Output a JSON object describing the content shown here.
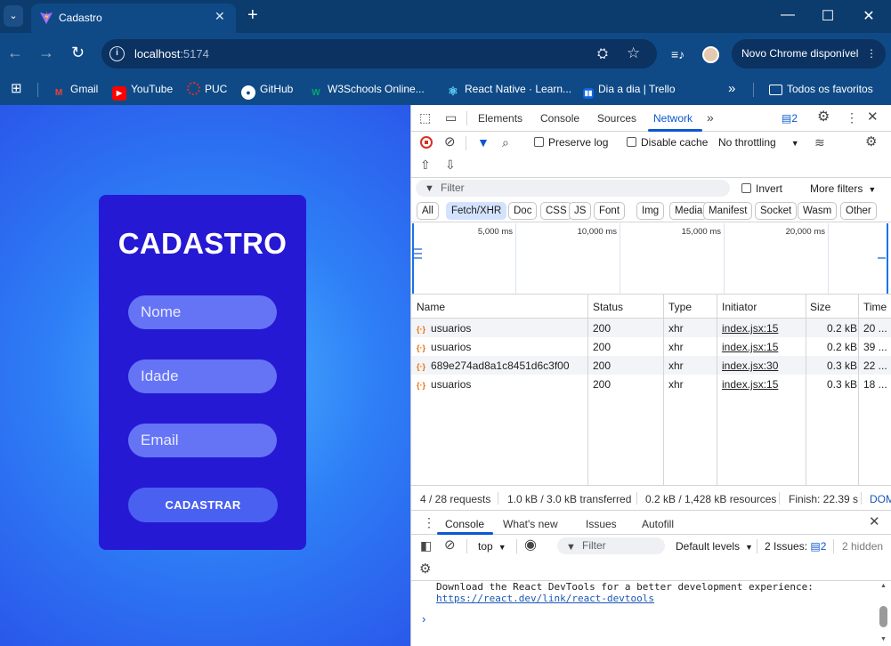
{
  "tab": {
    "title": "Cadastro",
    "close": "✕"
  },
  "window": {
    "minimize": "—",
    "maximize": "☐",
    "close": "✕",
    "new_tab": "+",
    "tab_search": "⌄"
  },
  "omnibox": {
    "host": "localhost",
    "port": ":5174"
  },
  "update_chip": {
    "label": "Novo Chrome disponível",
    "menu": "⋮"
  },
  "bookmarks": [
    {
      "label": "Gmail",
      "icon": "gmail-icon",
      "color": "#ea4335"
    },
    {
      "label": "YouTube",
      "icon": "youtube-icon",
      "color": "#ff0000"
    },
    {
      "label": "PUC",
      "icon": "puc-icon",
      "color": "#d93025"
    },
    {
      "label": "GitHub",
      "icon": "github-icon",
      "color": "#ffffff"
    },
    {
      "label": "W3Schools Online...",
      "icon": "w3schools-icon",
      "color": "#04aa6d"
    },
    {
      "label": "React Native · Learn...",
      "icon": "react-icon",
      "color": "#61dafb"
    },
    {
      "label": "Dia a dia | Trello",
      "icon": "trello-icon",
      "color": "#0c66e4"
    }
  ],
  "bookmarks_more": "»",
  "bookmarks_all": "Todos os favoritos",
  "form": {
    "title": "CADASTRO",
    "nome_placeholder": "Nome",
    "idade_placeholder": "Idade",
    "email_placeholder": "Email",
    "submit": "CADASTRAR"
  },
  "devtools": {
    "tabs": [
      "Elements",
      "Console",
      "Sources",
      "Network"
    ],
    "more_tabs": "»",
    "issues_count": "2",
    "preserve_log": "Preserve log",
    "disable_cache": "Disable cache",
    "throttling": "No throttling",
    "filter_placeholder": "Filter",
    "invert": "Invert",
    "more_filters": "More filters",
    "type_filters": [
      "All",
      "Fetch/XHR",
      "Doc",
      "CSS",
      "JS",
      "Font",
      "Img",
      "Media",
      "Manifest",
      "Socket",
      "Wasm",
      "Other"
    ],
    "active_filter": "Fetch/XHR",
    "timeline_ticks": [
      "5,000 ms",
      "10,000 ms",
      "15,000 ms",
      "20,000 ms"
    ],
    "columns": [
      "Name",
      "Status",
      "Type",
      "Initiator",
      "Size",
      "Time"
    ],
    "rows": [
      {
        "name": "usuarios",
        "status": "200",
        "type": "xhr",
        "initiator": "index.jsx:15",
        "size": "0.2 kB",
        "time": "20 ..."
      },
      {
        "name": "usuarios",
        "status": "200",
        "type": "xhr",
        "initiator": "index.jsx:15",
        "size": "0.2 kB",
        "time": "39 ..."
      },
      {
        "name": "689e274ad8a1c8451d6c3f00",
        "status": "200",
        "type": "xhr",
        "initiator": "index.jsx:30",
        "size": "0.3 kB",
        "time": "22 ..."
      },
      {
        "name": "usuarios",
        "status": "200",
        "type": "xhr",
        "initiator": "index.jsx:15",
        "size": "0.3 kB",
        "time": "18 ..."
      }
    ],
    "summary": {
      "requests": "4 / 28 requests",
      "transferred": "1.0 kB / 3.0 kB transferred",
      "resources": "0.2 kB / 1,428 kB resources",
      "finish": "Finish: 22.39 s",
      "dom": "DOM"
    },
    "drawer_tabs": [
      "Console",
      "What's new",
      "Issues",
      "Autofill"
    ],
    "console": {
      "context": "top",
      "filter_placeholder": "Filter",
      "levels": "Default levels",
      "issues_label": "2 Issues:",
      "issues_count": "2",
      "hidden": "2 hidden",
      "message": "Download the React DevTools for a better development experience:",
      "link": "https://react.dev/link/react-devtools",
      "prompt": "›"
    }
  }
}
